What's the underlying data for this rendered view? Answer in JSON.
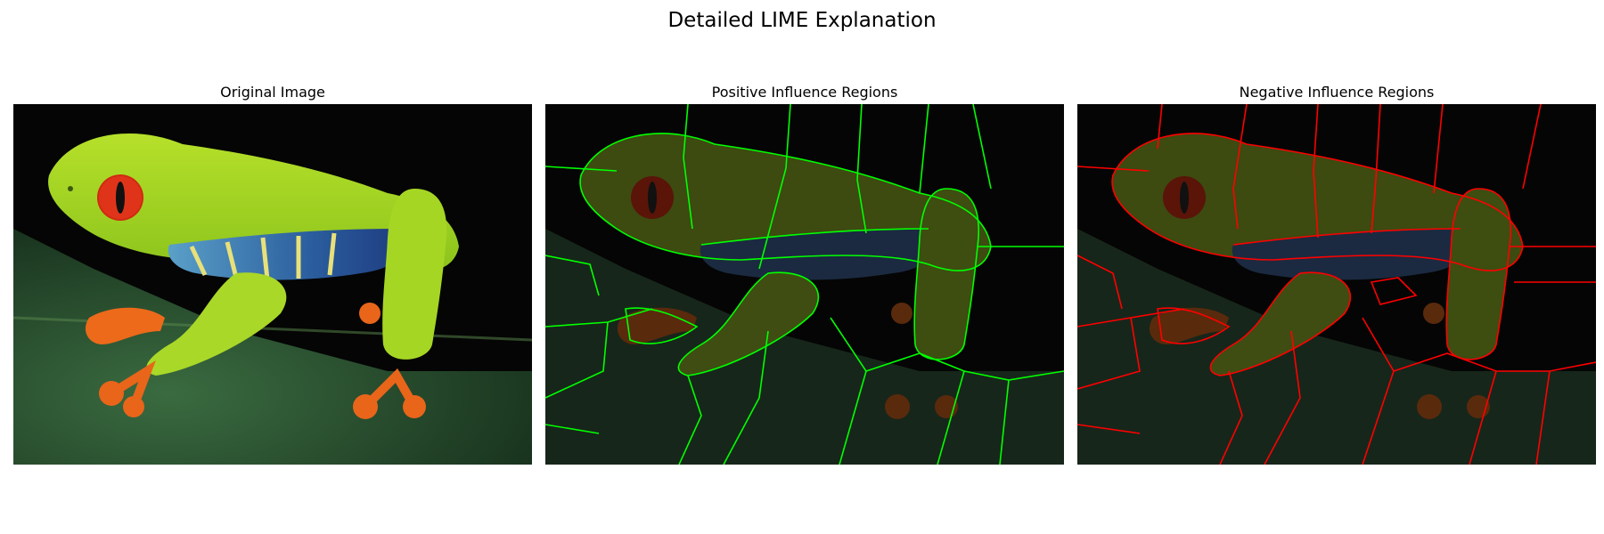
{
  "figure": {
    "title": "Detailed LIME Explanation"
  },
  "panels": [
    {
      "title": "Original Image",
      "overlay": "none"
    },
    {
      "title": "Positive Influence Regions",
      "overlay": "green",
      "boundary_color": "#00ff00"
    },
    {
      "title": "Negative Influence Regions",
      "overlay": "red",
      "boundary_color": "#ff0000"
    }
  ]
}
